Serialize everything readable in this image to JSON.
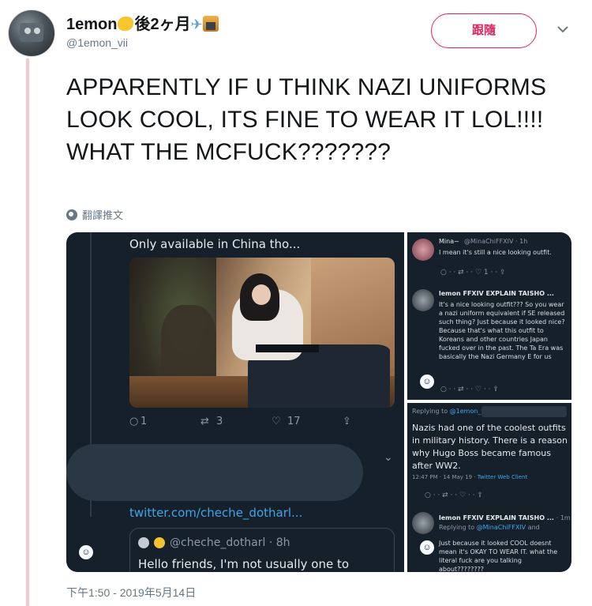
{
  "header": {
    "display_name": "1emon",
    "name_suffix": "後2ヶ月",
    "handle": "@1emon_vii",
    "follow_label": "跟隨"
  },
  "tweet": {
    "text": "APPARENTLY IF U THINK NAZI UNIFORMS LOOK COOL, ITS FINE TO WEAR IT LOL!!!! WHAT THE MCFUCK???????",
    "translate_label": "翻譯推文",
    "timestamp": "下午1:50 - 2019年5月14日"
  },
  "media": {
    "left": {
      "caption": "Only available in China tho...",
      "reply_count": "1",
      "retweet_count": "3",
      "like_count": "17",
      "link": "twitter.com/cheche_dotharl...",
      "quote_handle": "@cheche_dotharl · 8h",
      "quote_body": "Hello friends, I'm not usually one to"
    },
    "right_top": {
      "tweet1_name": "Mina~",
      "tweet1_meta": "@MinaChiFFXIV · 1h",
      "tweet1_text": "I mean it's still a nice looking outfit.",
      "tweet2_name": "lemon FFXIV EXPLAIN TAISHO ...",
      "tweet2_text": "It's a nice looking outfit??? So you wear a nazi uniform equivalent if SE released such thing? Just because it looked nice? Because that's what this outfit to Koreans and other countries Japan fucked over in the past. The Ta Era was basically the Nazi Germany E for us"
    },
    "right_bottom": {
      "replying_prefix": "Replying to",
      "replying_handle": "@1emon_vii",
      "replying_suffix": "and",
      "body": "Nazis had one of the coolest outfits in military history. There is a reason why Hugo Boss became famous after WW2.",
      "time": "12:47 PM · 14 May 19 ·",
      "client": "Twitter Web Client",
      "tweet2_name": "lemon FFXIV EXPLAIN TAISHO ...",
      "tweet2_time": "· 1m",
      "tweet2_replying_prefix": "Replying to",
      "tweet2_replying_handle": "@MinaChiFFXIV",
      "tweet2_replying_suffix": "and",
      "tweet2_text": "Just because it looked COOL doesnt mean it's OKAY TO WEAR IT. what the literal fuck are you talking about????????"
    }
  },
  "colors": {
    "follow_accent": "#e0245e",
    "thread_line": "#f4c9d3",
    "dark_panel": "#15202b",
    "link_blue": "#3ea6e8"
  },
  "icons": [
    "chevron-down-icon",
    "globe-icon",
    "reply-icon",
    "retweet-icon",
    "like-icon",
    "share-icon"
  ]
}
